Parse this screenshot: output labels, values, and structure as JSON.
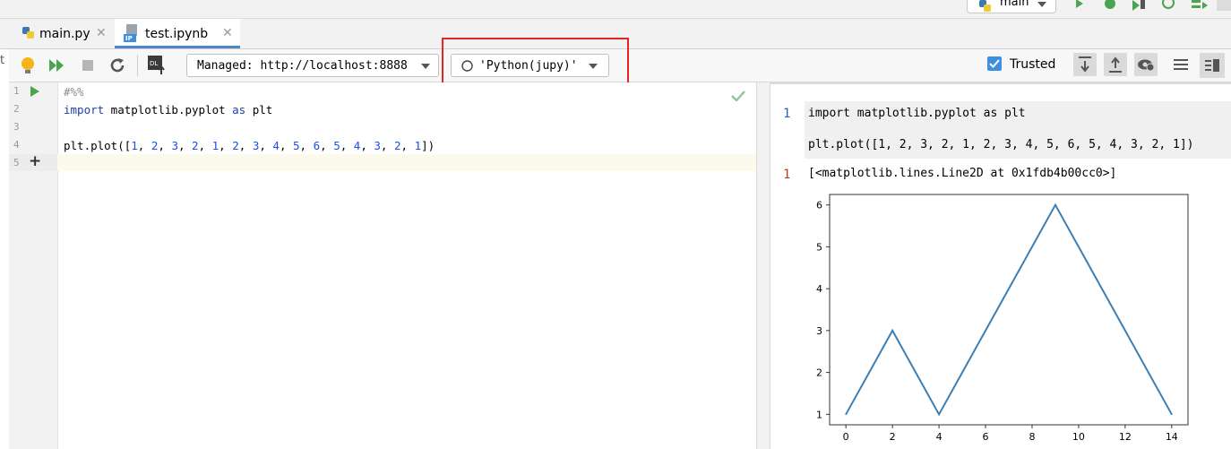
{
  "run_config": {
    "label": "main"
  },
  "tabs": [
    {
      "label": "main.py",
      "close": "✕"
    },
    {
      "label": "test.ipynb",
      "close": "✕",
      "badge": "IP"
    }
  ],
  "left_cut_text": "t",
  "toolbar": {
    "server": "Managed: http://localhost:8888",
    "kernel": "'Python(jupy)'",
    "trusted": "Trusted",
    "accent": "#3d8fe0",
    "highlight_color": "#e52424"
  },
  "editor": {
    "line_numbers": [
      "1",
      "2",
      "3",
      "4",
      "5"
    ],
    "lines": [
      "#%%",
      "import matplotlib.pyplot as plt",
      "",
      "plt.plot([1, 2, 3, 2, 1, 2, 3, 4, 5, 6, 5, 4, 3, 2, 1])",
      ""
    ],
    "add_cell": "+"
  },
  "preview": {
    "in_number": "1",
    "in_lines": [
      "import matplotlib.pyplot as plt",
      "plt.plot([1, 2, 3, 2, 1, 2, 3, 4, 5, 6, 5, 4, 3, 2, 1])"
    ],
    "out_number": "1",
    "out_text": "[<matplotlib.lines.Line2D at 0x1fdb4b00cc0>]"
  },
  "chart_data": {
    "type": "line",
    "x": [
      0,
      1,
      2,
      3,
      4,
      5,
      6,
      7,
      8,
      9,
      10,
      11,
      12,
      13,
      14
    ],
    "series": [
      {
        "values": [
          1,
          2,
          3,
          2,
          1,
          2,
          3,
          4,
          5,
          6,
          5,
          4,
          3,
          2,
          1
        ],
        "color": "#3b7fb5"
      }
    ],
    "xticks": [
      "0",
      "2",
      "4",
      "6",
      "8",
      "10",
      "12",
      "14"
    ],
    "yticks": [
      "1",
      "2",
      "3",
      "4",
      "5",
      "6"
    ],
    "xlim": [
      -0.7,
      14.7
    ],
    "ylim": [
      0.75,
      6.25
    ],
    "title": "",
    "xlabel": "",
    "ylabel": "",
    "grid": false
  }
}
